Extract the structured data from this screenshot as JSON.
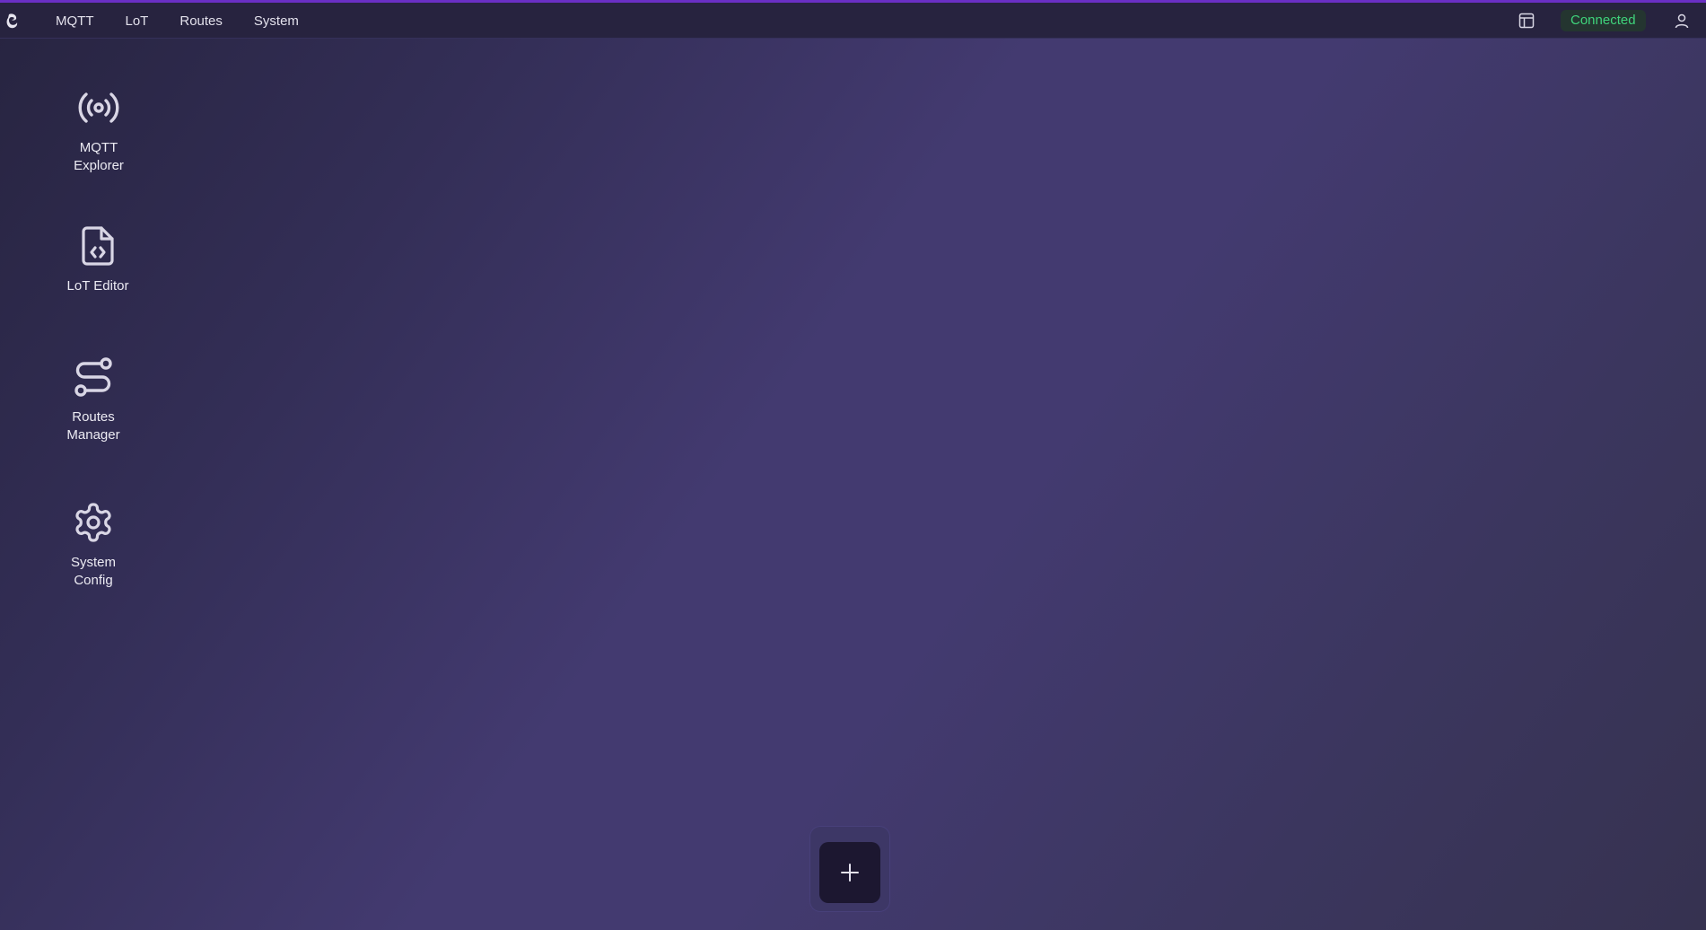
{
  "nav": {
    "items": [
      "MQTT",
      "LoT",
      "Routes",
      "System"
    ]
  },
  "status": {
    "label": "Connected",
    "color": "#3fd47b"
  },
  "desktop": {
    "icons": [
      {
        "label": "MQTT Explorer",
        "icon": "broadcast-icon"
      },
      {
        "label": "LoT Editor",
        "icon": "file-code-icon"
      },
      {
        "label": "Routes Manager",
        "icon": "route-icon"
      },
      {
        "label": "System Config",
        "icon": "gear-icon"
      }
    ]
  },
  "dock": {
    "add_icon": "plus-icon"
  },
  "colors": {
    "accent": "#6a2fc4",
    "topbar": "#27233f",
    "background": "#433a70"
  }
}
